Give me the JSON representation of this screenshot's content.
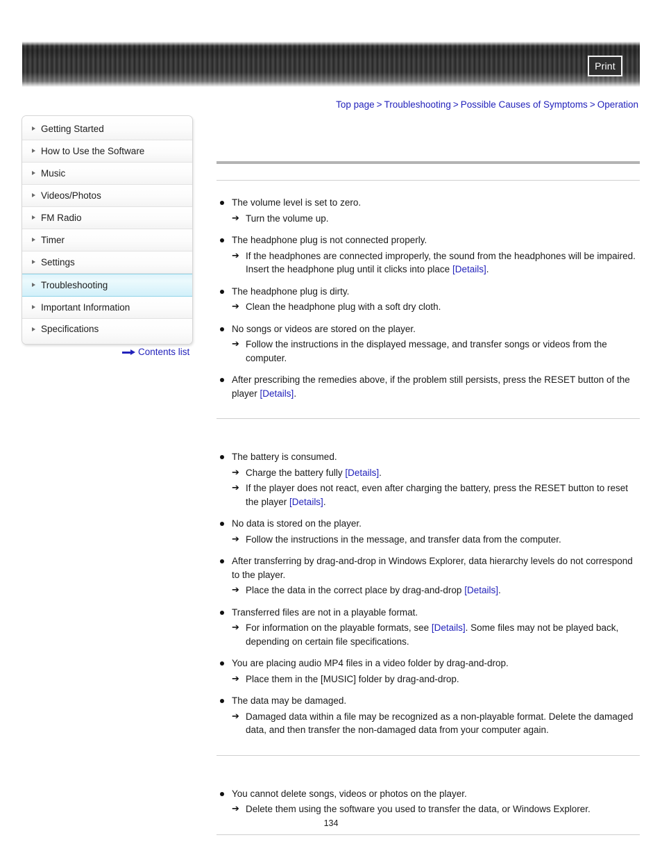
{
  "header": {
    "print_label": "Print"
  },
  "breadcrumb": {
    "items": [
      {
        "label": "Top page"
      },
      {
        "label": "Troubleshooting"
      },
      {
        "label": "Possible Causes of Symptoms"
      },
      {
        "label": "Operation"
      }
    ],
    "separator": ">"
  },
  "sidebar": {
    "items": [
      {
        "label": "Getting Started",
        "active": false
      },
      {
        "label": "How to Use the Software",
        "active": false
      },
      {
        "label": "Music",
        "active": false
      },
      {
        "label": "Videos/Photos",
        "active": false
      },
      {
        "label": "FM Radio",
        "active": false
      },
      {
        "label": "Timer",
        "active": false
      },
      {
        "label": "Settings",
        "active": false
      },
      {
        "label": "Troubleshooting",
        "active": true
      },
      {
        "label": "Important Information",
        "active": false
      },
      {
        "label": "Specifications",
        "active": false
      }
    ],
    "contents_list_label": "Contents list"
  },
  "main": {
    "sections": [
      {
        "title": "",
        "causes": [
          {
            "text": "The volume level is set to zero.",
            "remedies": [
              {
                "parts": [
                  {
                    "t": "Turn the volume up.",
                    "link": false
                  }
                ]
              }
            ]
          },
          {
            "text": "The headphone plug is not connected properly.",
            "remedies": [
              {
                "parts": [
                  {
                    "t": "If the headphones are connected improperly, the sound from the headphones will be impaired. Insert the headphone plug until it clicks into place ",
                    "link": false
                  },
                  {
                    "t": "[Details]",
                    "link": true
                  },
                  {
                    "t": ".",
                    "link": false
                  }
                ]
              }
            ]
          },
          {
            "text": "The headphone plug is dirty.",
            "remedies": [
              {
                "parts": [
                  {
                    "t": "Clean the headphone plug with a soft dry cloth.",
                    "link": false
                  }
                ]
              }
            ]
          },
          {
            "text": "No songs or videos are stored on the player.",
            "remedies": [
              {
                "parts": [
                  {
                    "t": "Follow the instructions in the displayed message, and transfer songs or videos from the computer.",
                    "link": false
                  }
                ]
              }
            ]
          },
          {
            "text_parts": [
              {
                "t": "After prescribing the remedies above, if the problem still persists, press the RESET button of the player ",
                "link": false
              },
              {
                "t": "[Details]",
                "link": true
              },
              {
                "t": ".",
                "link": false
              }
            ],
            "remedies": []
          }
        ]
      },
      {
        "title": "",
        "causes": [
          {
            "text": "The battery is consumed.",
            "remedies": [
              {
                "parts": [
                  {
                    "t": "Charge the battery fully ",
                    "link": false
                  },
                  {
                    "t": "[Details]",
                    "link": true
                  },
                  {
                    "t": ".",
                    "link": false
                  }
                ]
              },
              {
                "parts": [
                  {
                    "t": "If the player does not react, even after charging the battery, press the RESET button to reset the player ",
                    "link": false
                  },
                  {
                    "t": "[Details]",
                    "link": true
                  },
                  {
                    "t": ".",
                    "link": false
                  }
                ]
              }
            ]
          },
          {
            "text": "No data is stored on the player.",
            "remedies": [
              {
                "parts": [
                  {
                    "t": "Follow the instructions in the message, and transfer data from the computer.",
                    "link": false
                  }
                ]
              }
            ]
          },
          {
            "text": "After transferring by drag-and-drop in Windows Explorer, data hierarchy levels do not correspond to the player.",
            "remedies": [
              {
                "parts": [
                  {
                    "t": "Place the data in the correct place by drag-and-drop ",
                    "link": false
                  },
                  {
                    "t": "[Details]",
                    "link": true
                  },
                  {
                    "t": ".",
                    "link": false
                  }
                ]
              }
            ]
          },
          {
            "text": "Transferred files are not in a playable format.",
            "remedies": [
              {
                "parts": [
                  {
                    "t": "For information on the playable formats, see ",
                    "link": false
                  },
                  {
                    "t": "[Details]",
                    "link": true
                  },
                  {
                    "t": ". Some files may not be played back, depending on certain file specifications.",
                    "link": false
                  }
                ]
              }
            ]
          },
          {
            "text": "You are placing audio MP4 files in a video folder by drag-and-drop.",
            "remedies": [
              {
                "parts": [
                  {
                    "t": "Place them in the [MUSIC] folder by drag-and-drop.",
                    "link": false
                  }
                ]
              }
            ]
          },
          {
            "text": "The data may be damaged.",
            "remedies": [
              {
                "parts": [
                  {
                    "t": "Damaged data within a file may be recognized as a non-playable format. Delete the damaged data, and then transfer the non-damaged data from your computer again.",
                    "link": false
                  }
                ]
              }
            ]
          }
        ]
      },
      {
        "title": "",
        "causes": [
          {
            "text": "You cannot delete songs, videos or photos on the player.",
            "remedies": [
              {
                "parts": [
                  {
                    "t": "Delete them using the software you used to transfer the data, or Windows Explorer.",
                    "link": false
                  }
                ]
              }
            ]
          }
        ]
      }
    ]
  },
  "footer": {
    "page_number": "134"
  },
  "colors": {
    "link": "#2222bb",
    "highlight": "#d2f0fa",
    "rule": "#b3b3b3"
  }
}
